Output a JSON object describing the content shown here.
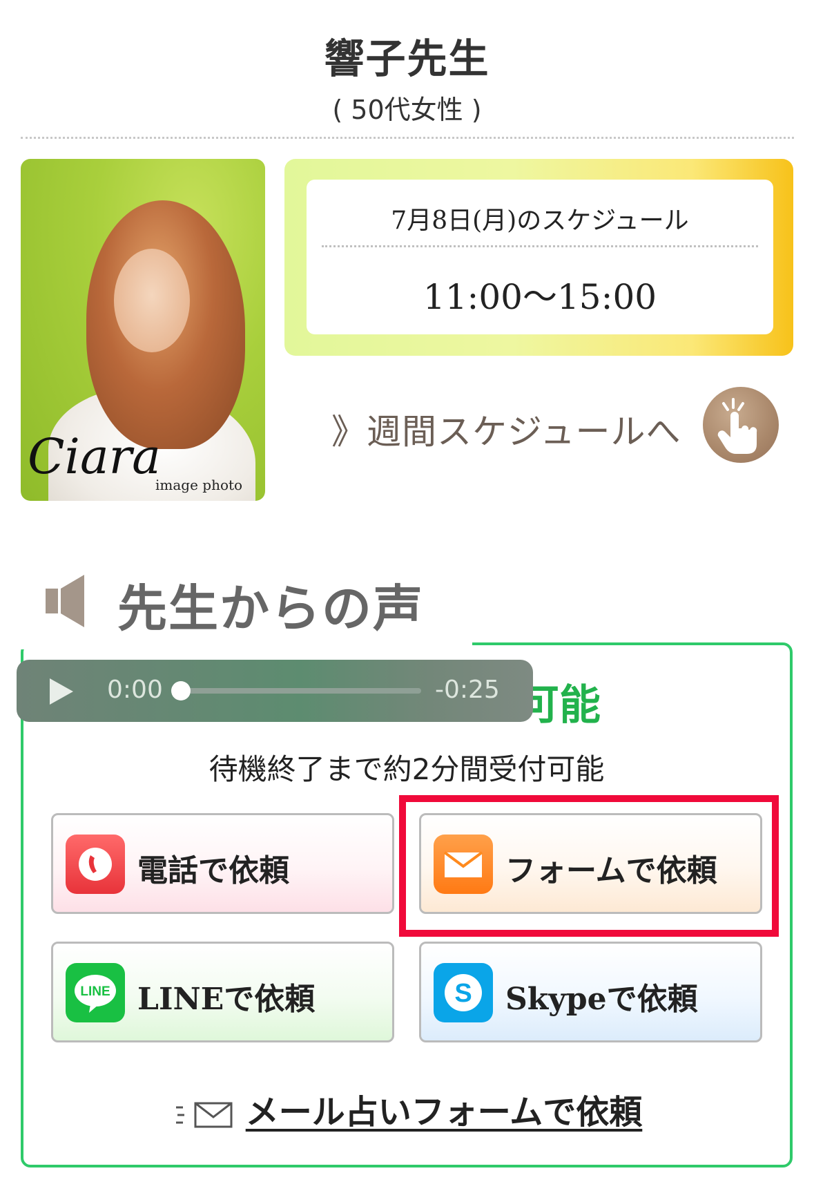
{
  "profile": {
    "name": "響子先生",
    "age": "( 50代女性 )",
    "photo_logo": "Ciara",
    "photo_caption": "image photo"
  },
  "schedule": {
    "date_label": "7月8日(月)のスケジュール",
    "time_range": "11:00〜15:00",
    "weekly_link": "》週間スケジュールへ"
  },
  "voice": {
    "title": "先生からの声",
    "player": {
      "current": "0:00",
      "remaining": "-0:25",
      "progress": 0
    }
  },
  "booking": {
    "status_text": "可能",
    "wait_text": "待機終了まで約2分間受付可能",
    "buttons": {
      "phone": "電話で依頼",
      "form": "フォームで依頼",
      "line": "LINEで依頼",
      "skype": "Skypeで依頼"
    },
    "mail_link": "メール占いフォームで依頼",
    "line_icon_text": "LINE",
    "skype_icon_text": "S"
  },
  "colors": {
    "accent_green": "#2fca6a",
    "highlight_red": "#f00a3a",
    "phone_icon": "#f0444a",
    "form_icon": "#ff8a1e",
    "line_icon": "#19c043",
    "skype_icon": "#0aa5e8"
  }
}
